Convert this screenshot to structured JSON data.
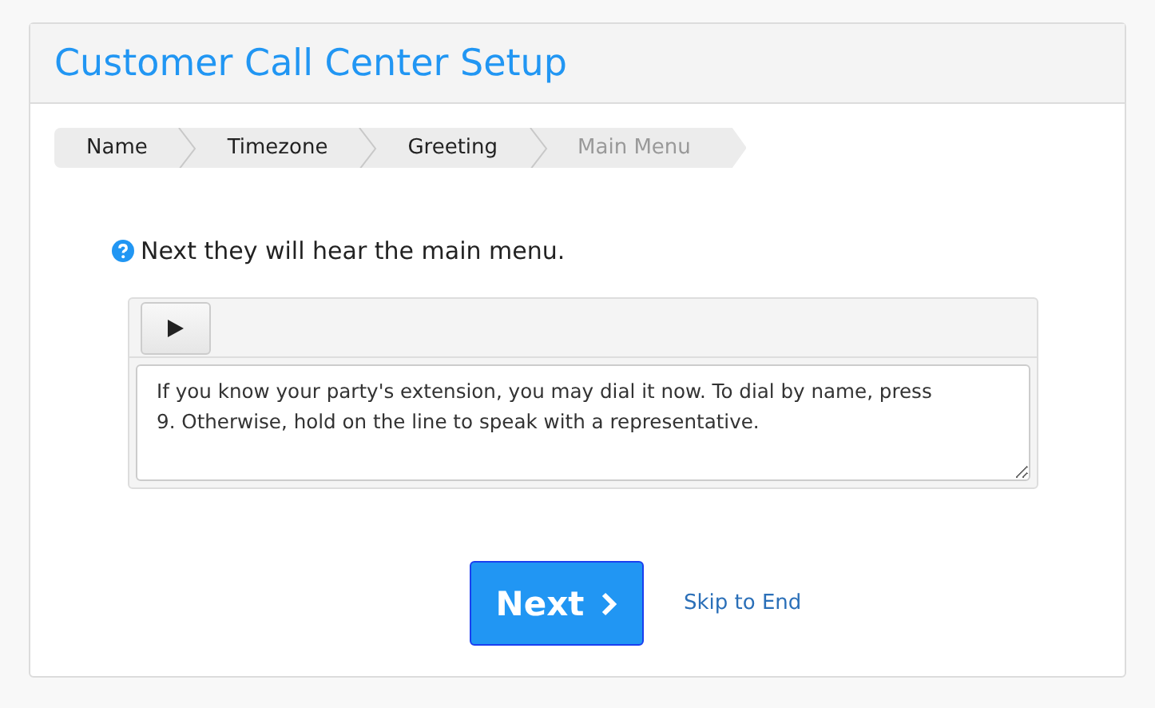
{
  "title": "Customer Call Center Setup",
  "steps": [
    {
      "label": "Name",
      "selected": false
    },
    {
      "label": "Timezone",
      "selected": false
    },
    {
      "label": "Greeting",
      "selected": false
    },
    {
      "label": "Main Menu",
      "selected": true
    }
  ],
  "prompt": "Next they will hear the main menu.",
  "message": "If you know your party's extension, you may dial it now. To dial by name, press 9. Otherwise, hold on the line to speak with a representative.",
  "next_button": "Next",
  "skip_link": "Skip to End"
}
